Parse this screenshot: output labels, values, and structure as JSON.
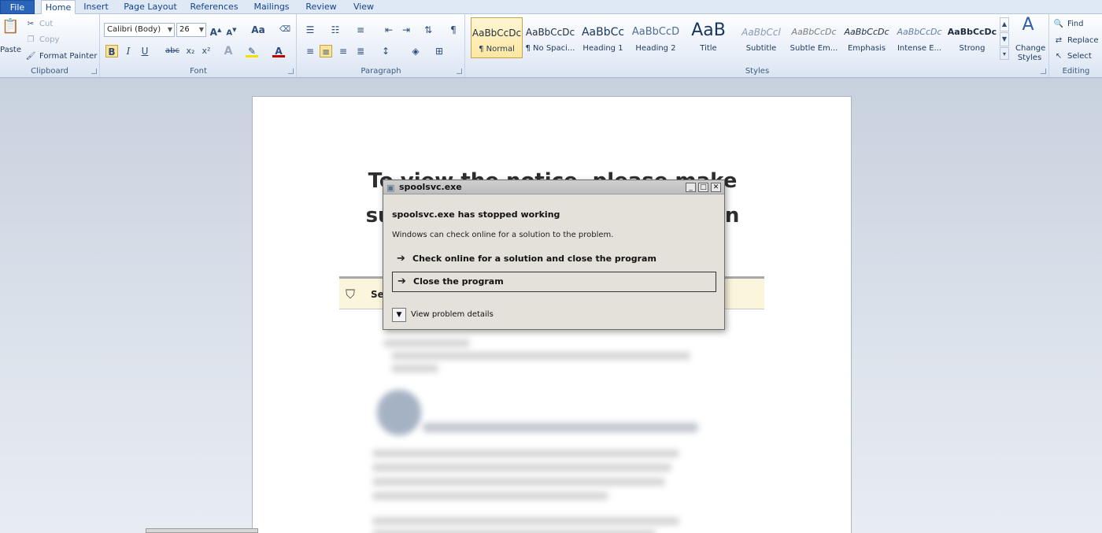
{
  "tabs": {
    "file": "File",
    "home": "Home",
    "insert": "Insert",
    "page_layout": "Page Layout",
    "references": "References",
    "mailings": "Mailings",
    "review": "Review",
    "view": "View"
  },
  "clipboard": {
    "paste": "Paste",
    "cut": "Cut",
    "copy": "Copy",
    "format_painter": "Format Painter",
    "label": "Clipboard"
  },
  "font": {
    "family": "Calibri (Body)",
    "size": "26",
    "label": "Font",
    "bold": "B",
    "italic": "I",
    "underline": "U",
    "strike": "abc",
    "subscript": "x₂",
    "superscript": "x²",
    "aa": "Aa"
  },
  "paragraph": {
    "label": "Paragraph",
    "pilcrow": "¶"
  },
  "styles": {
    "label": "Styles",
    "items": [
      {
        "preview": "AaBbCcDc",
        "name": "¶ Normal"
      },
      {
        "preview": "AaBbCcDc",
        "name": "¶ No Spaci..."
      },
      {
        "preview": "AaBbCc",
        "name": "Heading 1"
      },
      {
        "preview": "AaBbCcD",
        "name": "Heading 2"
      },
      {
        "preview": "AaB",
        "name": "Title"
      },
      {
        "preview": "AaBbCcl",
        "name": "Subtitle"
      },
      {
        "preview": "AaBbCcDc",
        "name": "Subtle Em..."
      },
      {
        "preview": "AaBbCcDc",
        "name": "Emphasis"
      },
      {
        "preview": "AaBbCcDc",
        "name": "Intense E..."
      },
      {
        "preview": "AaBbCcDc",
        "name": "Strong"
      }
    ],
    "change_styles_1": "Change",
    "change_styles_2": "Styles"
  },
  "editing": {
    "find": "Find",
    "replace": "Replace",
    "select": "Select",
    "label": "Editing"
  },
  "document": {
    "line1": "To view the notice, please make",
    "line2": "sure you have the latest version",
    "security_text": "Se"
  },
  "dialog": {
    "window_title": "spoolsvc.exe",
    "headline": "spoolsvc.exe has stopped working",
    "subtext": "Windows can check online for a solution to the problem.",
    "option_check": "Check online for a solution and close the program",
    "option_close": "Close the program",
    "details": "View problem details"
  }
}
